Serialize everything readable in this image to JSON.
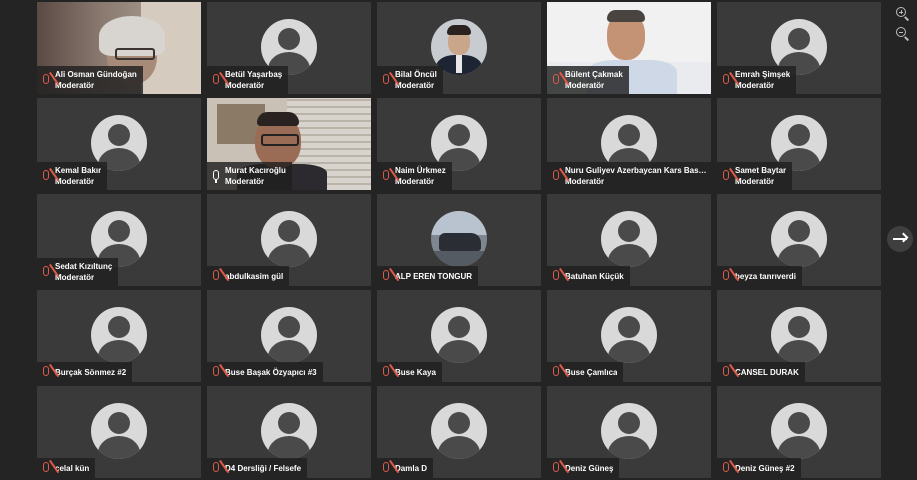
{
  "participants": [
    {
      "name": "Ali Osman Gündoğan",
      "role": "Moderatör",
      "mic": "muted",
      "view": "video1"
    },
    {
      "name": "Betül Yaşarbaş",
      "role": "Moderatör",
      "mic": "muted",
      "view": "avatar"
    },
    {
      "name": "Bilal Öncül",
      "role": "Moderatör",
      "mic": "muted",
      "view": "photo-suit"
    },
    {
      "name": "Bülent Çakmak",
      "role": "Moderatör",
      "mic": "muted",
      "view": "video2"
    },
    {
      "name": "Emrah Şimşek",
      "role": "Moderatör",
      "mic": "muted",
      "view": "avatar"
    },
    {
      "name": "Kemal Bakır",
      "role": "Moderatör",
      "mic": "muted",
      "view": "avatar"
    },
    {
      "name": "Murat Kacıroğlu",
      "role": "Moderatör",
      "mic": "on",
      "view": "video3",
      "active": true
    },
    {
      "name": "Naim Ürkmez",
      "role": "Moderatör",
      "mic": "muted",
      "view": "avatar"
    },
    {
      "name": "Nuru Guliyev Azerbaycan Kars Basko...",
      "role": "Moderatör",
      "mic": "muted",
      "view": "avatar"
    },
    {
      "name": "Samet Baytar",
      "role": "Moderatör",
      "mic": "muted",
      "view": "avatar"
    },
    {
      "name": "Sedat Kızıltunç",
      "role": "Moderatör",
      "mic": "muted",
      "view": "avatar"
    },
    {
      "name": "abdulkasim gül",
      "role": "",
      "mic": "muted",
      "view": "avatar"
    },
    {
      "name": "ALP EREN TONGUR",
      "role": "",
      "mic": "muted",
      "view": "photo-car"
    },
    {
      "name": "Batuhan Küçük",
      "role": "",
      "mic": "muted",
      "view": "avatar"
    },
    {
      "name": "beyza tanrıverdi",
      "role": "",
      "mic": "muted",
      "view": "avatar"
    },
    {
      "name": "Burçak Sönmez #2",
      "role": "",
      "mic": "muted",
      "view": "avatar"
    },
    {
      "name": "Buse Başak Özyapıcı #3",
      "role": "",
      "mic": "muted",
      "view": "avatar"
    },
    {
      "name": "Buse Kaya",
      "role": "",
      "mic": "muted",
      "view": "avatar"
    },
    {
      "name": "Buse Çamlıca",
      "role": "",
      "mic": "muted",
      "view": "avatar"
    },
    {
      "name": "CANSEL DURAK",
      "role": "",
      "mic": "muted",
      "view": "avatar"
    },
    {
      "name": "celal kün",
      "role": "",
      "mic": "muted",
      "view": "avatar"
    },
    {
      "name": "D4 Dersliği / Felsefe",
      "role": "",
      "mic": "muted",
      "view": "avatar"
    },
    {
      "name": "Damla D",
      "role": "",
      "mic": "muted",
      "view": "avatar"
    },
    {
      "name": "Deniz Güneş",
      "role": "",
      "mic": "muted",
      "view": "avatar"
    },
    {
      "name": "Deniz Güneş #2",
      "role": "",
      "mic": "muted",
      "view": "avatar"
    }
  ],
  "controls": {
    "zoom_in_icon": "zoom-in-icon",
    "zoom_out_icon": "zoom-out-icon",
    "next_page_icon": "arrow-right-icon"
  },
  "colors": {
    "background": "#242424",
    "tile": "#3a3a3a",
    "muted_mic": "#e05a4a",
    "active_border": "#e0866e"
  }
}
